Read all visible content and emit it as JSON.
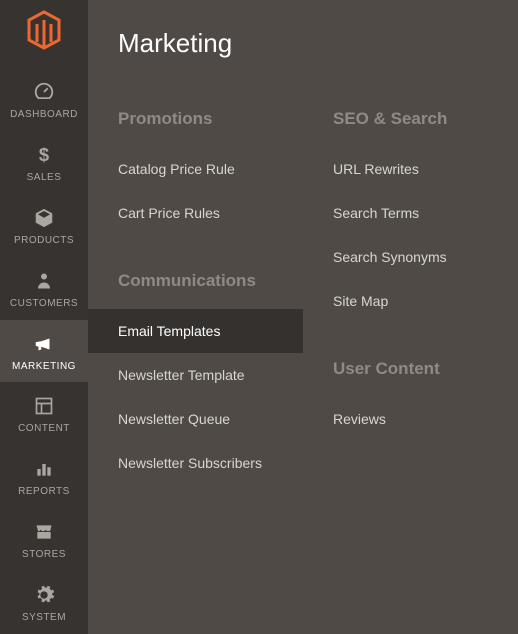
{
  "sidebar": {
    "items": [
      {
        "label": "DASHBOARD"
      },
      {
        "label": "SALES"
      },
      {
        "label": "PRODUCTS"
      },
      {
        "label": "CUSTOMERS"
      },
      {
        "label": "MARKETING"
      },
      {
        "label": "CONTENT"
      },
      {
        "label": "REPORTS"
      },
      {
        "label": "STORES"
      },
      {
        "label": "SYSTEM"
      }
    ]
  },
  "panel": {
    "title": "Marketing",
    "left": {
      "section1": {
        "header": "Promotions",
        "items": [
          "Catalog Price Rule",
          "Cart Price Rules"
        ]
      },
      "section2": {
        "header": "Communications",
        "items": [
          "Email Templates",
          "Newsletter Template",
          "Newsletter Queue",
          "Newsletter Subscribers"
        ]
      }
    },
    "right": {
      "section1": {
        "header": "SEO & Search",
        "items": [
          "URL Rewrites",
          "Search Terms",
          "Search Synonyms",
          "Site Map"
        ]
      },
      "section2": {
        "header": "User Content",
        "items": [
          "Reviews"
        ]
      }
    }
  }
}
